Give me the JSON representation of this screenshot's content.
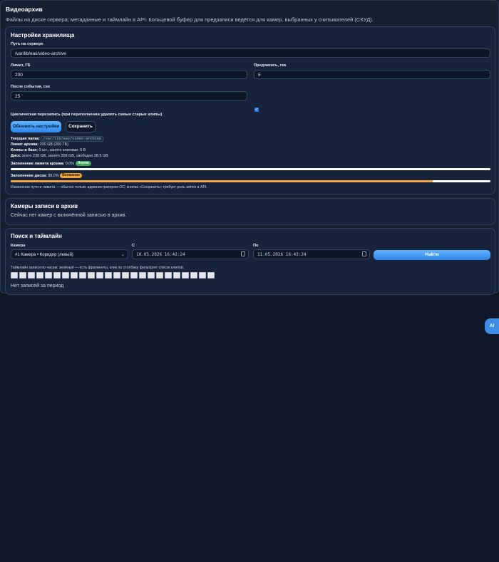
{
  "page": {
    "title": "Видеоархив",
    "subtitle": "Файлы на диске сервера; метаданные и таймлайн в API. Кольцевой буфер для предзаписи ведётся для камер, выбранных у считывателей (СКУД)."
  },
  "storage": {
    "title": "Настройки хранилища",
    "path_label": "Путь на сервере",
    "path_value": "/var/lib/eas/video-archive",
    "limit_label": "Лимит, ГБ",
    "limit_value": "200",
    "prerecord_label": "Предзапись, сек",
    "prerecord_value": "5",
    "post_label": "После события, сек",
    "post_value": "25",
    "cyclic_label": "Циклическая перезапись (при переполнении удалять самые старые клипы)",
    "cyclic_checked": true,
    "refresh_button": "Обновить настройки",
    "save_button": "Сохранить",
    "current_folder_label": "Текущая папка:",
    "current_folder_value": "/var/lib/eas/video-archive",
    "archive_limit_label": "Лимит архива:",
    "archive_limit_value": "200 GB (200 ГБ)",
    "clips_label": "Клипы в базе:",
    "clips_value": "0 шт., занято клипами: 0 B",
    "disk_label": "Диск:",
    "disk_value": "всего 238 GB, занято 209 GB, свободно 28.5 GB",
    "archive_fill_label": "Заполнение лимита архива:",
    "archive_fill_value": "0.0%",
    "archive_fill_fraction": 0.0,
    "archive_fill_badge": "Норма",
    "disk_fill_label": "Заполнение диска:",
    "disk_fill_value": "88.0%",
    "disk_fill_fraction": 0.88,
    "disk_fill_badge": "Внимание",
    "note": "Изменение пути и лимита — обычно только администратором ОС; кнопка «Сохранить» требует роль admin в API."
  },
  "cameras": {
    "title": "Камеры записи в архив",
    "empty_text": "Сейчас нет камер с включённой записью в архив."
  },
  "search": {
    "title": "Поиск и таймлайн",
    "camera_label": "Камера",
    "camera_value": "#1 Камера • Коридор (левый)",
    "from_label": "С",
    "from_value": "10.05.2026 16:42:24",
    "to_label": "По",
    "to_value": "11.05.2026 16:43:24",
    "find_button": "Найти",
    "timeline_hint": "Таймлайн записи по часам: зелёный — есть фрагменты, клик по столбику фильтрует список клипов.",
    "timeline_slots": 24,
    "empty_text": "Нет записей за период"
  },
  "assistant": {
    "button": "AI"
  },
  "colors": {
    "background": "#0f1828",
    "card": "#17233a",
    "accent": "#3d8fe8",
    "ok": "#3fa45a",
    "warn": "#f1a33f"
  }
}
